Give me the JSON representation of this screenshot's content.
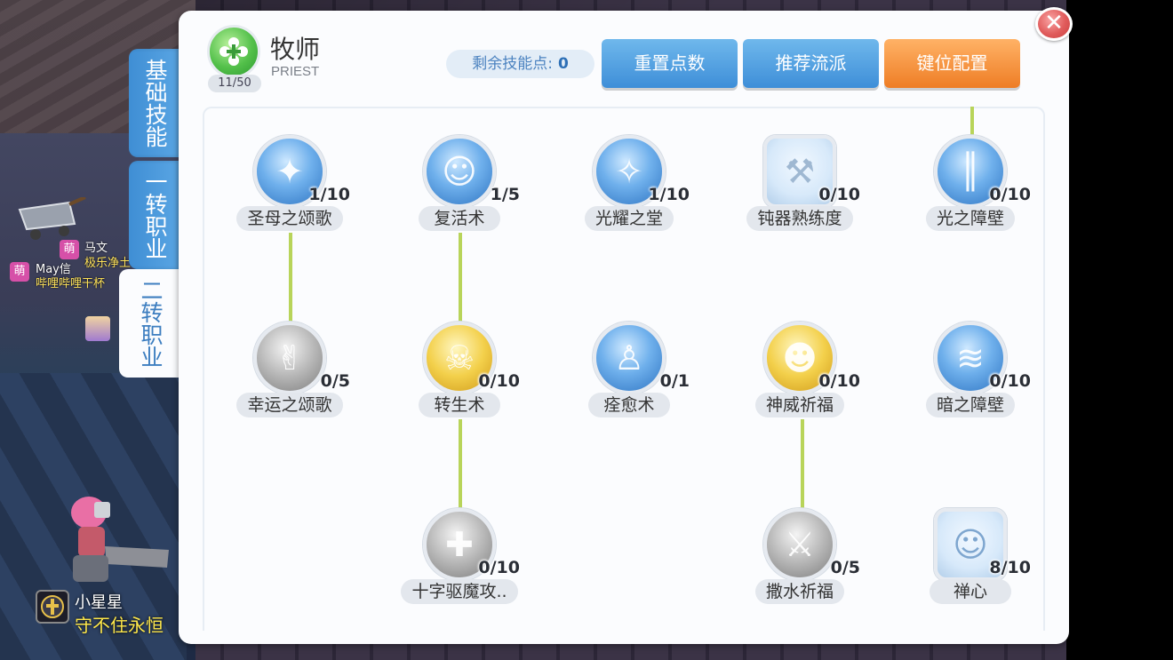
{
  "class": {
    "name": "牧师",
    "english": "PRIEST",
    "level": "11/50"
  },
  "points": {
    "label": "剩余技能点:",
    "value": "0"
  },
  "buttons": {
    "reset": "重置点数",
    "recommend": "推荐流派",
    "keybind": "键位配置"
  },
  "tabs": {
    "basic": "基础技能",
    "job1": "一转职业",
    "job2": "二转职业"
  },
  "skills": [
    {
      "name": "圣母之颂歌",
      "level": "1/10"
    },
    {
      "name": "复活术",
      "level": "1/5"
    },
    {
      "name": "光耀之堂",
      "level": "1/10"
    },
    {
      "name": "钝器熟练度",
      "level": "0/10"
    },
    {
      "name": "光之障壁",
      "level": "0/10"
    },
    {
      "name": "幸运之颂歌",
      "level": "0/5"
    },
    {
      "name": "转生术",
      "level": "0/10"
    },
    {
      "name": "痊愈术",
      "level": "0/1"
    },
    {
      "name": "神威祈福",
      "level": "0/10"
    },
    {
      "name": "暗之障壁",
      "level": "0/10"
    },
    {
      "name": "十字驱魔攻..",
      "level": "0/10"
    },
    {
      "name": "撒水祈福",
      "level": "0/5"
    },
    {
      "name": "禅心",
      "level": "8/10"
    }
  ],
  "chat": {
    "badge": "萌",
    "line1_name": "马文",
    "line1_text": "极乐净土",
    "line2_name": "May信",
    "line2_text": "哔哩哔哩干杯"
  },
  "player": {
    "name": "小星星",
    "guild": "守不住永恒"
  }
}
